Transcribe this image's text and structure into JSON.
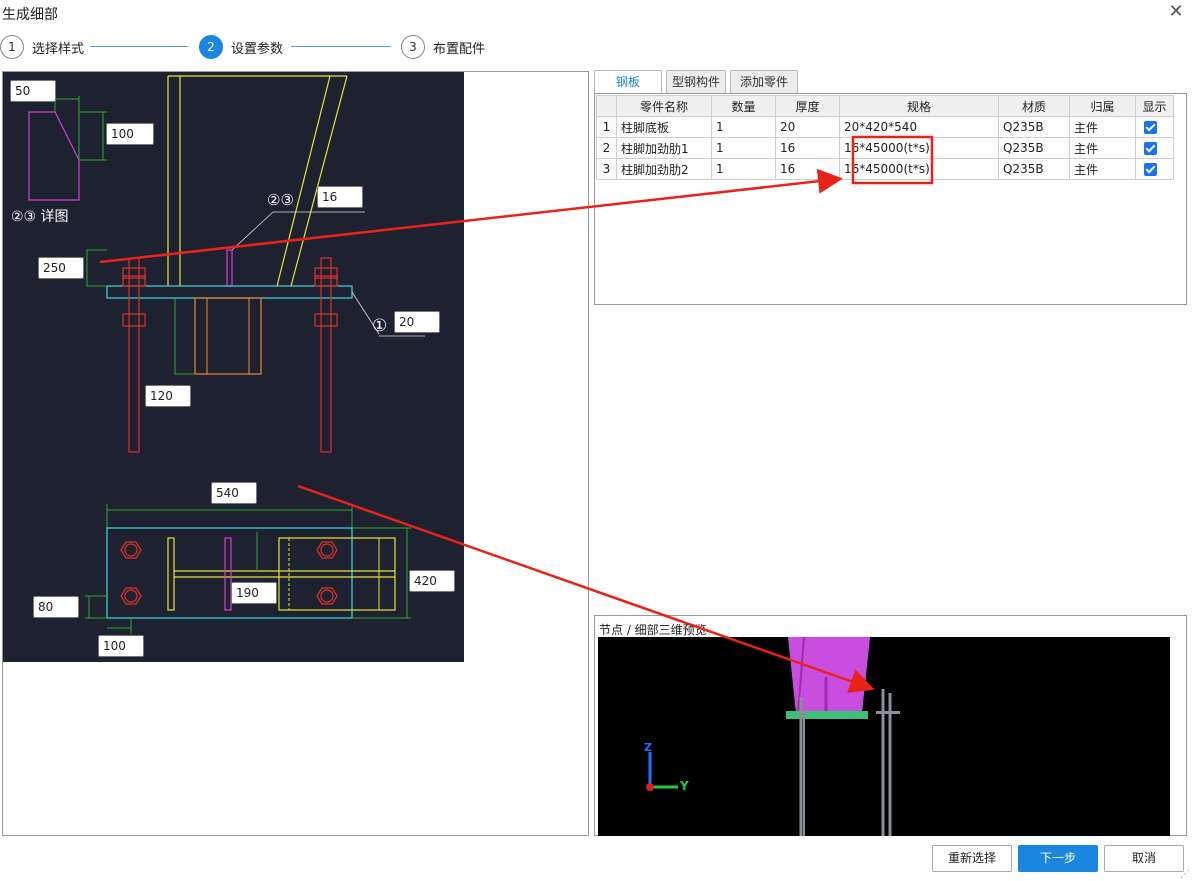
{
  "window": {
    "title": "生成细部",
    "close_glyph": "✕"
  },
  "steps": [
    {
      "num": "1",
      "label": "选择样式"
    },
    {
      "num": "2",
      "label": "设置参数"
    },
    {
      "num": "3",
      "label": "布置配件"
    }
  ],
  "drawing": {
    "detail_label": "②③ 详图",
    "marker_23": "②③",
    "marker_1": "①",
    "dims": {
      "d50": "50",
      "d100_top": "100",
      "d16": "16",
      "d250": "250",
      "d20": "20",
      "d120": "120",
      "d540": "540",
      "d420": "420",
      "d190": "190",
      "d80": "80",
      "d100_bottom": "100"
    }
  },
  "tabs": [
    "钢板",
    "型钢构件",
    "添加零件"
  ],
  "table": {
    "headers": [
      "",
      "零件名称",
      "数量",
      "厚度",
      "规格",
      "材质",
      "归属",
      "显示"
    ],
    "rows": [
      {
        "idx": "1",
        "name": "柱脚底板",
        "qty": "1",
        "thickness": "20",
        "spec": "20*420*540",
        "material": "Q235B",
        "owner": "主件",
        "show": true
      },
      {
        "idx": "2",
        "name": "柱脚加劲肋1",
        "qty": "1",
        "thickness": "16",
        "spec": "16*45000(t*s)",
        "material": "Q235B",
        "owner": "主件",
        "show": true
      },
      {
        "idx": "3",
        "name": "柱脚加劲肋2",
        "qty": "1",
        "thickness": "16",
        "spec": "16*45000(t*s)",
        "material": "Q235B",
        "owner": "主件",
        "show": true
      }
    ]
  },
  "preview": {
    "label": "节点 / 细部三维预览",
    "axis_z": "Z",
    "axis_y": "Y"
  },
  "buttons": {
    "reselect": "重新选择",
    "next": "下一步",
    "cancel": "取消"
  },
  "colors": {
    "accent": "#1a86e0",
    "cad_bg": "#1e2230",
    "annotation_red": "#e8231a"
  }
}
